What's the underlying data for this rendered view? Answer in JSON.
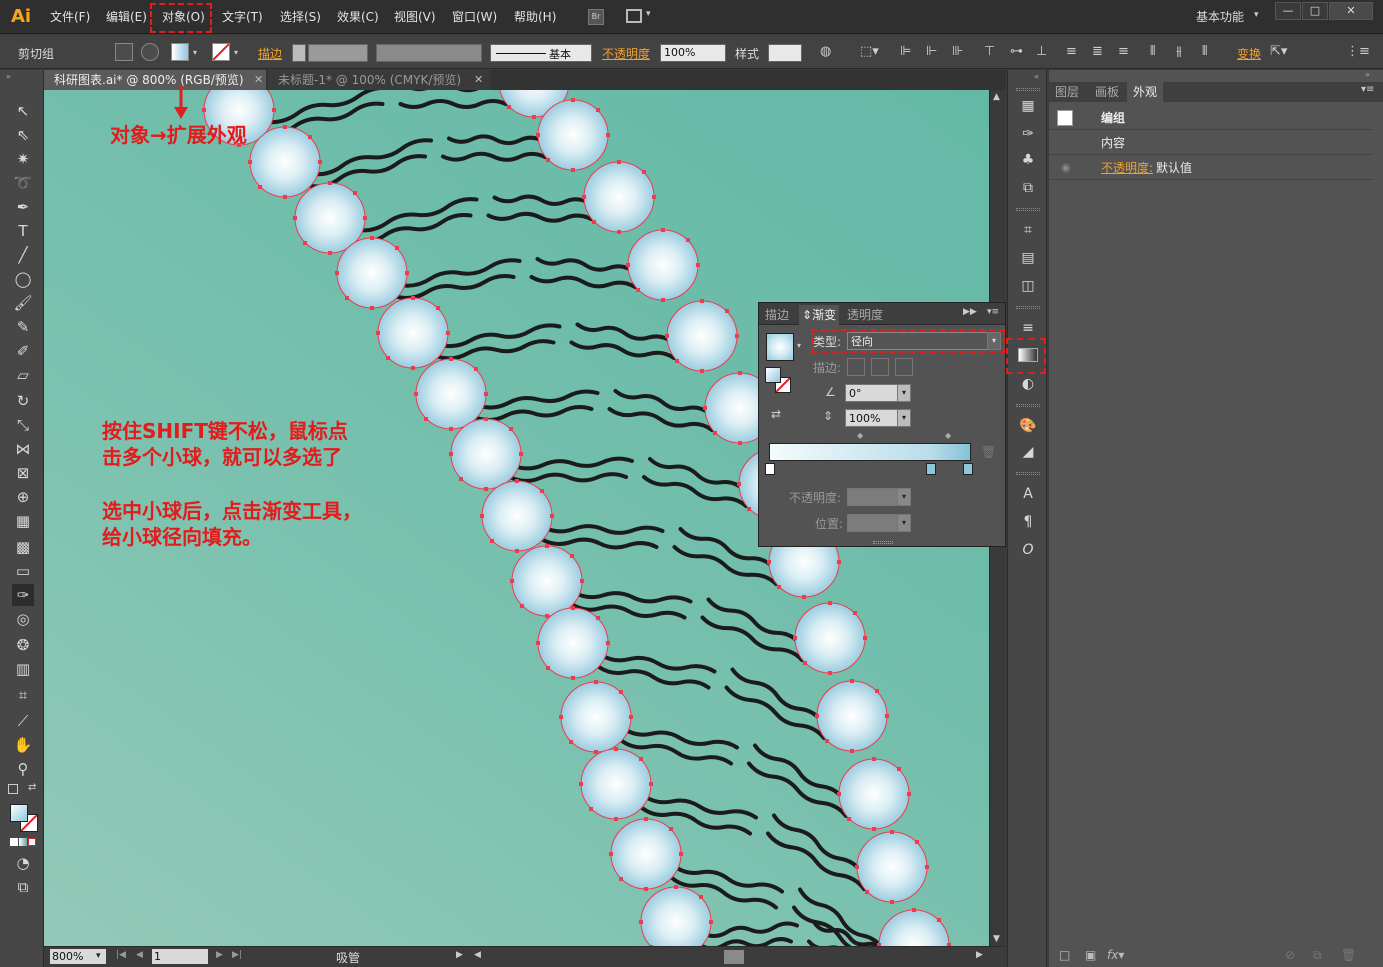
{
  "app": {
    "logo": "Ai",
    "menus": [
      "文件(F)",
      "编辑(E)",
      "对象(O)",
      "文字(T)",
      "选择(S)",
      "效果(C)",
      "视图(V)",
      "窗口(W)",
      "帮助(H)"
    ],
    "bridge": "Br",
    "workspace": "基本功能",
    "window_controls": [
      "—",
      "□",
      "✕"
    ]
  },
  "control_bar": {
    "selection_label": "剪切组",
    "stroke_label": "描边",
    "stroke_style": "基本",
    "opacity_label": "不透明度",
    "opacity_value": "100%",
    "style_label": "样式",
    "transform_label": "变换"
  },
  "tabs": [
    {
      "label": "科研图表.ai* @ 800% (RGB/预览)",
      "close": "✕"
    },
    {
      "label": "未标题-1* @ 100% (CMYK/预览)",
      "close": "✕"
    }
  ],
  "annotations": {
    "menu_hint": "对象→扩展外观",
    "shift_hint_line1": "按住SHIFT键不松，鼠标点",
    "shift_hint_line2": "击多个小球，就可以多选了",
    "gradient_hint_line1": "选中小球后，点击渐变工具，",
    "gradient_hint_line2": "给小球径向填充。"
  },
  "gradient_panel": {
    "tabs": [
      "描边",
      "渐变",
      "透明度"
    ],
    "type_label": "类型:",
    "type_value": "径向",
    "stroke_label": "描边:",
    "angle_value": "0°",
    "ratio_value": "100%",
    "opacity_label": "不透明度:",
    "position_label": "位置:",
    "colors": {
      "stop_start": "#f4fbfd",
      "stop_mid": "#b9dde9",
      "stop_end": "#86c2da"
    }
  },
  "appearance_panel": {
    "tabs": [
      "图层",
      "画板",
      "外观"
    ],
    "group_label": "编组",
    "content_label": "内容",
    "opacity_label": "不透明度:",
    "opacity_value": "默认值",
    "footer_fx": "fx"
  },
  "status_bar": {
    "zoom": "800%",
    "page": "1",
    "tool": "吸管"
  },
  "colors": {
    "canvas_bg": "#72bfac",
    "ball_center": "#ffffff",
    "ball_edge": "#8ec7dc",
    "selection_red": "#ee3b4e",
    "annotation_red": "#e51a1a",
    "accent_orange": "#f0a030"
  }
}
